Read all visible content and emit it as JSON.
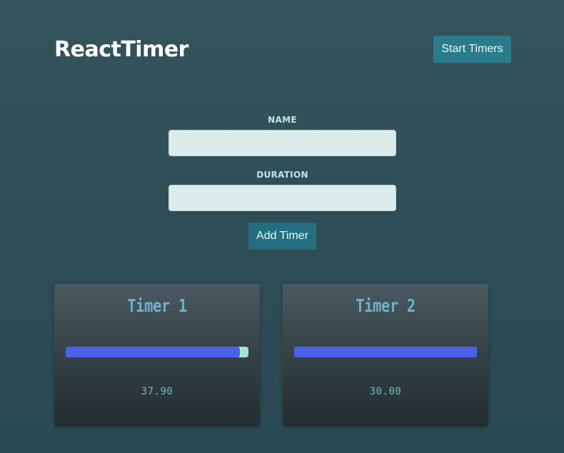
{
  "header": {
    "title": "ReactTimer",
    "start_button": "Start Timers"
  },
  "form": {
    "name_label": "NAME",
    "name_value": "",
    "duration_label": "DURATION",
    "duration_value": "",
    "add_button": "Add Timer"
  },
  "timers": [
    {
      "name": "Timer 1",
      "value": "37.90",
      "progress": 0.955
    },
    {
      "name": "Timer 2",
      "value": "30.00",
      "progress": 1.0
    }
  ],
  "colors": {
    "accent": "#2a7b8c",
    "progress_fill": "#4a60e8",
    "progress_track": "#a6e2d6",
    "timer_title": "#6fb1cb"
  }
}
